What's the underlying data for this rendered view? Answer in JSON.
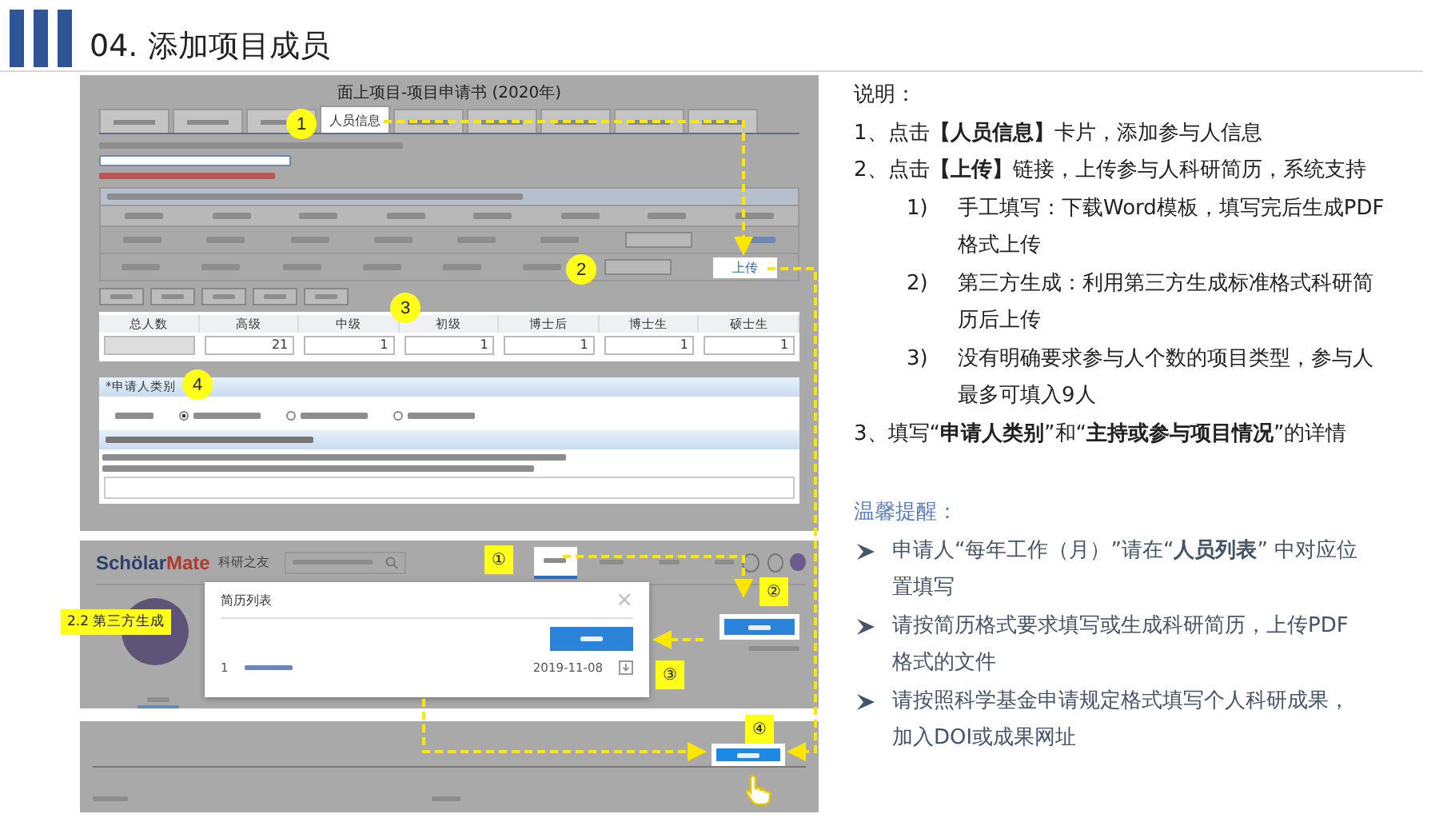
{
  "header": {
    "title": "04. 添加项目成员"
  },
  "form_screenshot": {
    "title": "面上项目-项目申请书 (2020年)",
    "tabs": [
      {
        "selected": false
      },
      {
        "selected": false
      },
      {
        "selected": false
      },
      {
        "label": "人员信息",
        "selected": true
      },
      {
        "selected": false
      },
      {
        "selected": false
      },
      {
        "selected": false
      },
      {
        "selected": false
      },
      {
        "selected": false
      }
    ],
    "upload_link": "上传",
    "count_table": {
      "columns": [
        "总人数",
        "高级",
        "中级",
        "初级",
        "博士后",
        "博士生",
        "硕士生"
      ],
      "values": [
        "21",
        "1",
        "1",
        "1",
        "1",
        "1"
      ]
    },
    "category_title": "*申请人类别",
    "radios": [
      {
        "selected": true
      },
      {
        "selected": false
      },
      {
        "selected": false
      }
    ],
    "markers": [
      "1",
      "2",
      "3",
      "4"
    ]
  },
  "scholarmate": {
    "logo": [
      "Schölar",
      "Mate"
    ],
    "slogan": "科研之友",
    "markers": [
      "①",
      "②",
      "③",
      "④"
    ],
    "callout": "2.2 第三方生成",
    "dialog": {
      "title": "简历列表",
      "close": "×",
      "row_index": "1",
      "row_date": "2019-11-08"
    }
  },
  "notes": {
    "title": "说明：",
    "items": [
      {
        "kind": "step",
        "text": "1、点击**【人员信息】**卡片，添加参与人信息"
      },
      {
        "kind": "step",
        "text": "2、点击**【上传】**链接，上传参与人科研简历，系统支持"
      },
      {
        "kind": "sub",
        "num": "1)",
        "text": "手工填写：下载Word模板，填写完后生成PDF格式上传"
      },
      {
        "kind": "sub",
        "num": "2)",
        "text": "第三方生成：利用第三方生成标准格式科研简历后上传"
      },
      {
        "kind": "sub",
        "num": "3)",
        "text": "没有明确要求参与人个数的项目类型，参与人最多可填入9人"
      },
      {
        "kind": "step",
        "text": "3、填写“**申请人类别**”和“**主持或参与项目情况**”的详情"
      }
    ]
  },
  "tips": {
    "title": "温馨提醒：",
    "items": [
      "申请人“每年工作（月）”请在“**人员列表**” 中对应位置填写",
      "请按简历格式要求填写或生成科研简历，上传PDF格式的文件",
      "请按照科学基金申请规定格式填写个人科研成果，加入DOI或成果网址"
    ]
  }
}
